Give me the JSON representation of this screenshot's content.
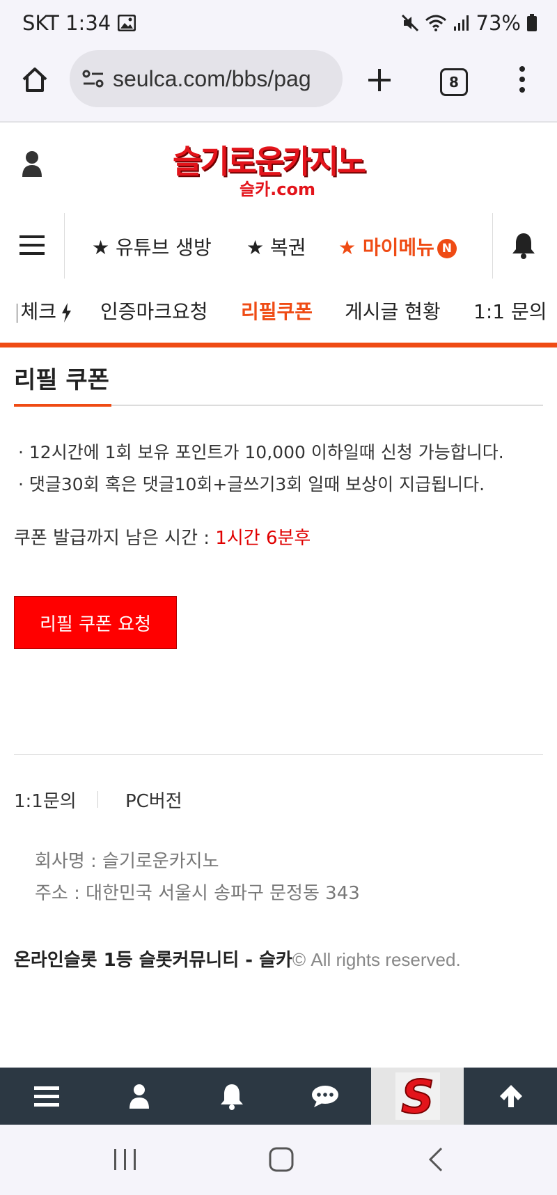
{
  "status_bar": {
    "carrier_time": "SKT 1:34",
    "battery": "73%"
  },
  "browser": {
    "url": "seulca.com/bbs/pag",
    "tab_count": "8"
  },
  "header": {
    "logo_main": "슬기로운카지노",
    "logo_sub": "슬카.com"
  },
  "main_nav": {
    "items": [
      {
        "label": "★ 유튜브 생방"
      },
      {
        "label": "★ 복권"
      },
      {
        "label": "★ 마이메뉴",
        "badge": "N"
      }
    ]
  },
  "sub_nav": {
    "items": [
      {
        "label": "체크"
      },
      {
        "label": "인증마크요청"
      },
      {
        "label": "리필쿠폰"
      },
      {
        "label": "게시글 현황"
      },
      {
        "label": "1:1 문의"
      }
    ]
  },
  "page": {
    "title": "리필 쿠폰",
    "notices": [
      "· 12시간에 1회 보유 포인트가 10,000 이하일때 신청 가능합니다.",
      "· 댓글30회 혹은 댓글10회+글쓰기3회 일때 보상이 지급됩니다."
    ],
    "remaining_label": "쿠폰 발급까지 남은 시간 : ",
    "remaining_value": "1시간 6분후",
    "request_button": "리필 쿠폰 요청"
  },
  "footer": {
    "link_inquiry": "1:1문의",
    "link_pc": "PC버전",
    "company": "회사명 : 슬기로운카지노",
    "address": "주소 : 대한민국 서울시 송파구 문정동 343",
    "copyright_bold": "온라인슬롯 1등 슬롯커뮤니티 - 슬카",
    "copyright_rest": "© All rights reserved."
  },
  "bottom_bar": {
    "logo_letter": "S"
  },
  "colors": {
    "accent": "#ef4b14",
    "button_red": "#ff0000",
    "bottom_bar": "#2c3843"
  }
}
